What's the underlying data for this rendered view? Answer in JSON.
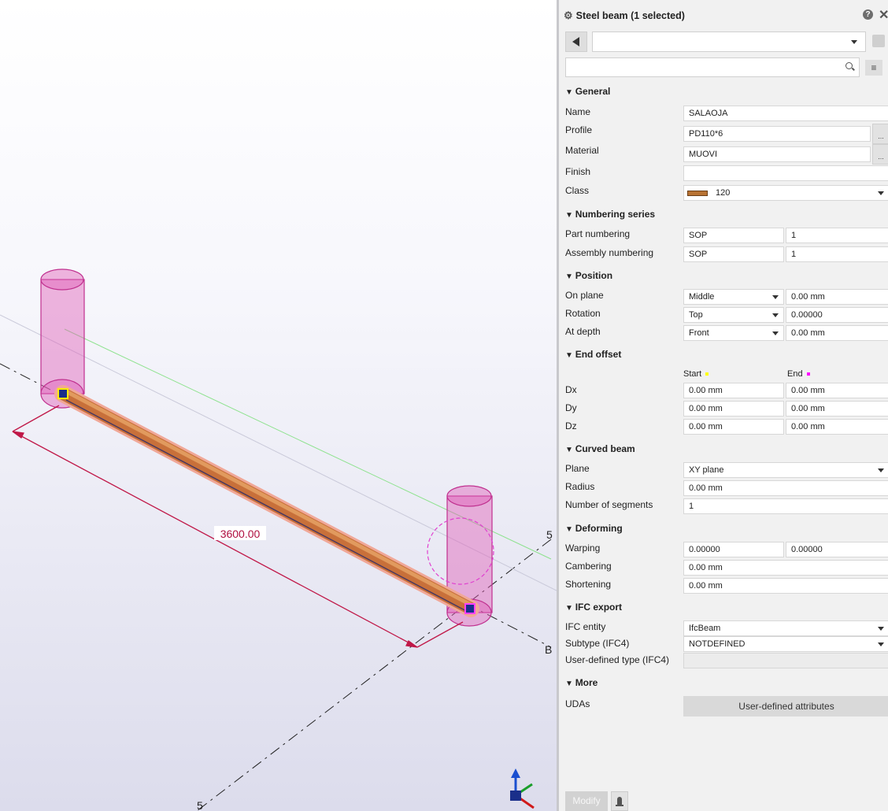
{
  "viewport": {
    "dimension_label": "3600.00",
    "grid_label_5_top": "5",
    "grid_label_5_bottom": "5",
    "grid_label_b": "B"
  },
  "panel": {
    "title": "Steel beam (1 selected)",
    "colors": {
      "class_swatch": "#b87333",
      "start_marker": "#ffff00",
      "end_marker": "#ff00ff",
      "selection": "#e040a0"
    },
    "sections": {
      "general": "General",
      "numbering": "Numbering series",
      "position": "Position",
      "end_offset": "End offset",
      "curved": "Curved beam",
      "deforming": "Deforming",
      "ifc": "IFC export",
      "more": "More"
    },
    "general": {
      "name_label": "Name",
      "name_value": "SALAOJA",
      "profile_label": "Profile",
      "profile_value": "PD110*6",
      "material_label": "Material",
      "material_value": "MUOVI",
      "finish_label": "Finish",
      "finish_value": "",
      "class_label": "Class",
      "class_value": "120",
      "browse": "..."
    },
    "numbering": {
      "part_label": "Part numbering",
      "part_prefix": "SOP",
      "part_start": "1",
      "assembly_label": "Assembly numbering",
      "assembly_prefix": "SOP",
      "assembly_start": "1"
    },
    "position": {
      "onplane_label": "On plane",
      "onplane_value": "Middle",
      "onplane_offset": "0.00 mm",
      "rotation_label": "Rotation",
      "rotation_value": "Top",
      "rotation_offset": "0.00000",
      "atdepth_label": "At depth",
      "atdepth_value": "Front",
      "atdepth_offset": "0.00 mm"
    },
    "end_offset": {
      "start_header": "Start",
      "end_header": "End",
      "dx_label": "Dx",
      "dx_start": "0.00 mm",
      "dx_end": "0.00 mm",
      "dy_label": "Dy",
      "dy_start": "0.00 mm",
      "dy_end": "0.00 mm",
      "dz_label": "Dz",
      "dz_start": "0.00 mm",
      "dz_end": "0.00 mm"
    },
    "curved": {
      "plane_label": "Plane",
      "plane_value": "XY plane",
      "radius_label": "Radius",
      "radius_value": "0.00 mm",
      "segments_label": "Number of segments",
      "segments_value": "1"
    },
    "deforming": {
      "warping_label": "Warping",
      "warping_start": "0.00000",
      "warping_end": "0.00000",
      "cambering_label": "Cambering",
      "cambering_value": "0.00 mm",
      "shortening_label": "Shortening",
      "shortening_value": "0.00 mm"
    },
    "ifc": {
      "entity_label": "IFC entity",
      "entity_value": "IfcBeam",
      "subtype_label": "Subtype (IFC4)",
      "subtype_value": "NOTDEFINED",
      "userdefined_label": "User-defined type (IFC4)",
      "userdefined_value": ""
    },
    "more": {
      "udas_label": "UDAs",
      "udas_button": "User-defined attributes"
    },
    "footer": {
      "modify": "Modify"
    }
  }
}
